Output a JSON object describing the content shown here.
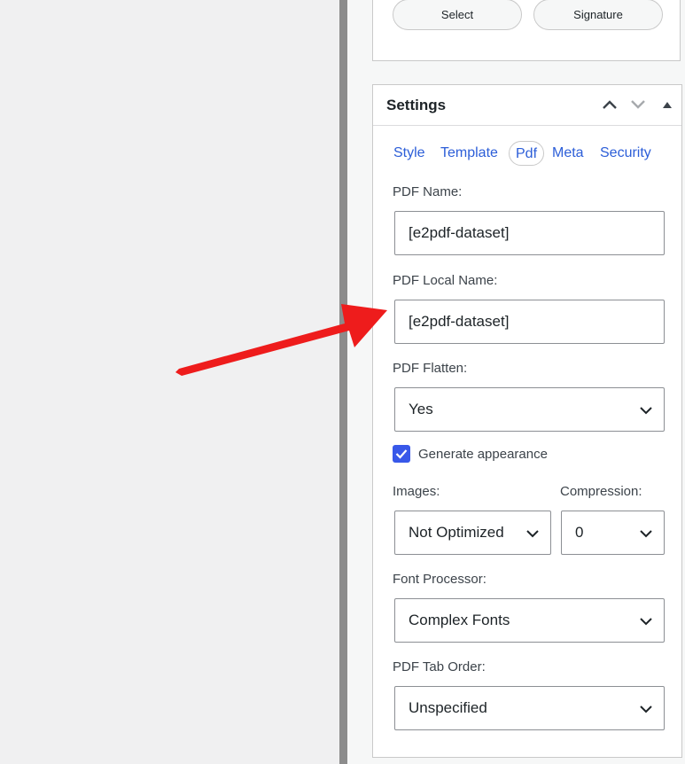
{
  "toolbar": {
    "select_label": "Select",
    "signature_label": "Signature"
  },
  "settings": {
    "title": "Settings",
    "tabs": [
      "Style",
      "Template",
      "Pdf",
      "Meta",
      "Security"
    ],
    "active_tab": "Pdf",
    "pdf_name": {
      "label": "PDF Name:",
      "value": "[e2pdf-dataset]"
    },
    "pdf_local_name": {
      "label": "PDF Local Name:",
      "value": "[e2pdf-dataset]"
    },
    "pdf_flatten": {
      "label": "PDF Flatten:",
      "value": "Yes"
    },
    "generate_appearance": {
      "label": "Generate appearance",
      "checked": true
    },
    "images": {
      "label": "Images:",
      "value": "Not Optimized"
    },
    "compression": {
      "label": "Compression:",
      "value": "0"
    },
    "font_processor": {
      "label": "Font Processor:",
      "value": "Complex Fonts"
    },
    "pdf_tab_order": {
      "label": "PDF Tab Order:",
      "value": "Unspecified"
    }
  },
  "colors": {
    "accent": "#3858e9",
    "link": "#2c5ed8",
    "annotation_arrow": "#ee1c1c"
  },
  "icons": [
    "chevron-up-icon",
    "chevron-down-icon",
    "collapse-triangle-icon",
    "select-chevron-icon",
    "checkmark-icon",
    "annotation-arrow"
  ]
}
